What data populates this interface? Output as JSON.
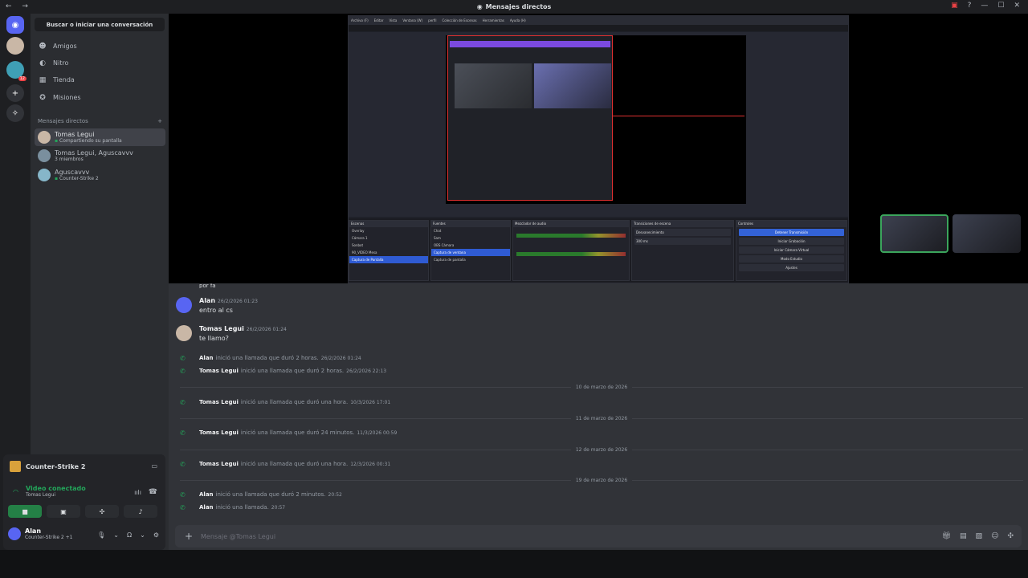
{
  "window": {
    "title": "Mensajes directos",
    "nav_glyphs": "← →"
  },
  "guilds": {
    "home_icon": "discord-icon",
    "badge": "12"
  },
  "sidebar": {
    "search_label": "Buscar o iniciar una conversación",
    "nav": [
      {
        "label": "Amigos",
        "icon": "friends-icon"
      },
      {
        "label": "Nitro",
        "icon": "nitro-icon"
      },
      {
        "label": "Tienda",
        "icon": "store-icon"
      },
      {
        "label": "Misiones",
        "icon": "quests-icon"
      }
    ],
    "dm_header": "Mensajes directos",
    "dm_add": "+",
    "dms": [
      {
        "name": "Tomas Legui",
        "sub": "Compartiendo su pantalla"
      },
      {
        "name": "Tomas Legui, Aguscavvv",
        "sub": "3 miembros"
      },
      {
        "name": "Aguscavvv",
        "sub": "Counter-Strike 2"
      }
    ]
  },
  "userpanel": {
    "game": "Counter-Strike 2",
    "voice_status": "Video conectado",
    "voice_channel": "Tomas Legui",
    "username": "Alan",
    "user_status": "Counter-Strike 2 +1"
  },
  "obs": {
    "menu": [
      "Archivo (F)",
      "Editar",
      "Vista",
      "Ventana (W)",
      "perfil",
      "Colección de Escenas",
      "Herramientas",
      "Ayuda (H)"
    ],
    "docks": {
      "scenes_title": "Escenas",
      "scenes": [
        "Overlay",
        "Cámara 1",
        "Sonbot",
        "90_VIDEO Mesa",
        "Captura de Pantalla"
      ],
      "sources_title": "Fuentes",
      "sources": [
        "Chat",
        "Sam",
        "OBS Cámara",
        "Captura de ventana",
        "Captura de pantalla"
      ],
      "mixer_title": "Mezclador de audio",
      "transitions_title": "Transiciones de escena",
      "transition": "Desvanecimiento",
      "duration": "300 ms",
      "controls_title": "Controles",
      "controls": [
        "Detener Transmisión",
        "Iniciar Grabación",
        "Iniciar Cámara Virtual",
        "Modo Estudio",
        "Ajustes"
      ]
    }
  },
  "messages": {
    "partial_top": "por fa",
    "items": [
      {
        "author": "Alan",
        "time": "26/2/2026 01:23",
        "text": "entro al cs"
      },
      {
        "author": "Tomas Legui",
        "time": "26/2/2026 01:24",
        "text": "te llamo?"
      }
    ],
    "calls": [
      {
        "who": "Alan",
        "text": "inició una llamada que duró 2 horas.",
        "ts": "26/2/2026 01:24"
      },
      {
        "who": "Tomas Legui",
        "text": "inició una llamada que duró 2 horas.",
        "ts": "26/2/2026 22:13"
      },
      {
        "who": "Tomas Legui",
        "text": "inició una llamada que duró una hora.",
        "ts": "10/3/2026 17:01"
      },
      {
        "who": "Tomas Legui",
        "text": "inició una llamada que duró 24 minutos.",
        "ts": "11/3/2026 00:59"
      },
      {
        "who": "Tomas Legui",
        "text": "inició una llamada que duró una hora.",
        "ts": "12/3/2026 00:31"
      },
      {
        "who": "Alan",
        "text": "inició una llamada que duró 2 minutos.",
        "ts": "20:52"
      },
      {
        "who": "Alan",
        "text": "inició una llamada.",
        "ts": "20:57"
      }
    ],
    "dividers": [
      "10 de marzo de 2026",
      "11 de marzo de 2026",
      "12 de marzo de 2026",
      "19 de marzo de 2026"
    ]
  },
  "composer": {
    "placeholder": "Mensaje @Tomas Legui"
  },
  "colors": {
    "accent": "#5865f2",
    "online": "#23a55a",
    "obs_selection": "#2f5bd3",
    "obs_red": "#e03030"
  }
}
